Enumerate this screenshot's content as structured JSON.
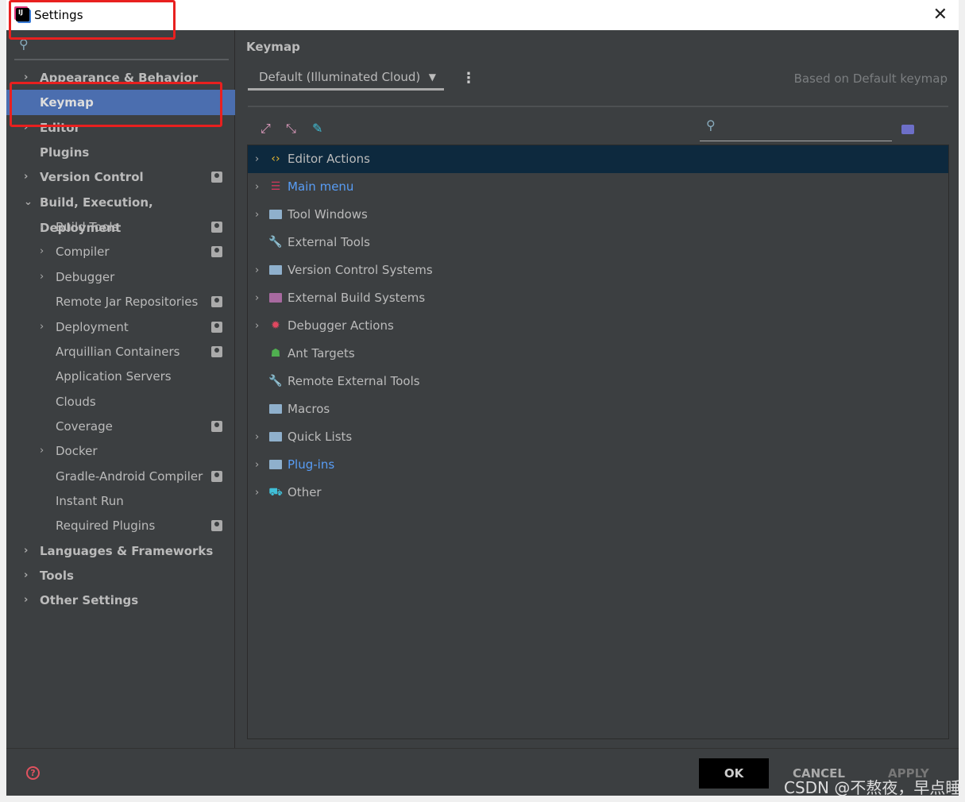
{
  "window": {
    "title": "Settings",
    "close": "✕"
  },
  "sidebar": {
    "search_icon": "search-icon",
    "items": [
      {
        "label": "Appearance & Behavior",
        "bold": true,
        "level": 0,
        "chev": "›"
      },
      {
        "label": "Keymap",
        "bold": true,
        "level": 0,
        "selected": true
      },
      {
        "label": "Editor",
        "bold": true,
        "level": 0,
        "chev": "›"
      },
      {
        "label": "Plugins",
        "bold": true,
        "level": 0
      },
      {
        "label": "Version Control",
        "bold": true,
        "level": 0,
        "chev": "›",
        "badge": true
      },
      {
        "label": "Build, Execution, Deployment",
        "bold": true,
        "level": 0,
        "chev": "⌄"
      },
      {
        "label": "Build Tools",
        "level": 1,
        "chev": "›",
        "badge": true
      },
      {
        "label": "Compiler",
        "level": 1,
        "chev": "›",
        "badge": true
      },
      {
        "label": "Debugger",
        "level": 1,
        "chev": "›"
      },
      {
        "label": "Remote Jar Repositories",
        "level": 1,
        "badge": true
      },
      {
        "label": "Deployment",
        "level": 1,
        "chev": "›",
        "badge": true
      },
      {
        "label": "Arquillian Containers",
        "level": 1,
        "badge": true
      },
      {
        "label": "Application Servers",
        "level": 1
      },
      {
        "label": "Clouds",
        "level": 1
      },
      {
        "label": "Coverage",
        "level": 1,
        "badge": true
      },
      {
        "label": "Docker",
        "level": 1,
        "chev": "›"
      },
      {
        "label": "Gradle-Android Compiler",
        "level": 1,
        "badge": true
      },
      {
        "label": "Instant Run",
        "level": 1
      },
      {
        "label": "Required Plugins",
        "level": 1,
        "badge": true
      },
      {
        "label": "Languages & Frameworks",
        "bold": true,
        "level": 0,
        "chev": "›"
      },
      {
        "label": "Tools",
        "bold": true,
        "level": 0,
        "chev": "›"
      },
      {
        "label": "Other Settings",
        "bold": true,
        "level": 0,
        "chev": "›"
      }
    ]
  },
  "main": {
    "heading": "Keymap",
    "keymap_value": "Default (Illuminated Cloud)",
    "based_on": "Based on Default keymap",
    "tree": [
      {
        "label": "Editor Actions",
        "icon": "code-icon",
        "chev": true,
        "selected": true
      },
      {
        "label": "Main menu",
        "icon": "menu-icon",
        "chev": true,
        "blue": true
      },
      {
        "label": "Tool Windows",
        "icon": "folder-icon",
        "chev": true
      },
      {
        "label": "External Tools",
        "icon": "wrench-icon"
      },
      {
        "label": "Version Control Systems",
        "icon": "folder-icon",
        "chev": true
      },
      {
        "label": "External Build Systems",
        "icon": "folder-icon",
        "chev": true
      },
      {
        "label": "Debugger Actions",
        "icon": "bug-icon",
        "chev": true
      },
      {
        "label": "Ant Targets",
        "icon": "ant-icon"
      },
      {
        "label": "Remote External Tools",
        "icon": "wrench-icon"
      },
      {
        "label": "Macros",
        "icon": "folder-icon"
      },
      {
        "label": "Quick Lists",
        "icon": "folder-icon",
        "chev": true
      },
      {
        "label": "Plug-ins",
        "icon": "folder-icon",
        "chev": true,
        "blue": true
      },
      {
        "label": "Other",
        "icon": "basket-icon",
        "chev": true
      }
    ]
  },
  "footer": {
    "ok": "OK",
    "cancel": "CANCEL",
    "apply": "APPLY",
    "help": "?"
  },
  "watermark": "CSDN @不熬夜，早点睡",
  "colors": {
    "selection": "#4b6eaf",
    "tree_selection": "#0d293e",
    "highlight_box": "#e8201f"
  }
}
